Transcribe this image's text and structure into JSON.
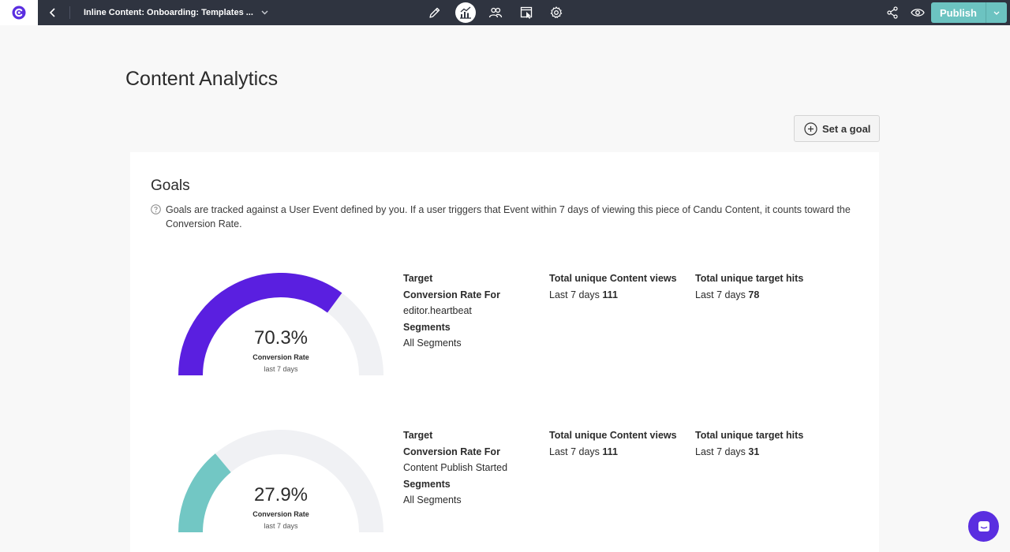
{
  "topbar": {
    "title": "Inline Content: Onboarding: Templates ...",
    "publish_label": "Publish",
    "icons": [
      "candu-logo-icon",
      "back-icon",
      "chevron-down-icon",
      "pencil-icon",
      "analytics-icon",
      "users-icon",
      "select-icon",
      "gear-icon",
      "share-icon",
      "eye-icon"
    ]
  },
  "page": {
    "title": "Content Analytics",
    "set_goal_label": "Set a goal"
  },
  "goals": {
    "title": "Goals",
    "help_text": "Goals are tracked against a User Event defined by you. If a user triggers that Event within 7 days of viewing this piece of Candu Content, it counts toward the Conversion Rate.",
    "items": [
      {
        "rate": "70.3%",
        "rate_value": 70.3,
        "rate_label": "Conversion Rate",
        "period": "last 7 days",
        "color": "#5a1fe0",
        "target_label": "Target",
        "conv_for_label": "Conversion Rate For",
        "event": "editor.heartbeat",
        "segments_label": "Segments",
        "segments": "All Segments",
        "views_label": "Total unique Content views",
        "views_prefix": "Last 7 days",
        "views": "111",
        "hits_label": "Total unique target hits",
        "hits_prefix": "Last 7 days",
        "hits": "78"
      },
      {
        "rate": "27.9%",
        "rate_value": 27.9,
        "rate_label": "Conversion Rate",
        "period": "last 7 days",
        "color": "#72c7c4",
        "target_label": "Target",
        "conv_for_label": "Conversion Rate For",
        "event": "Content Publish Started",
        "segments_label": "Segments",
        "segments": "All Segments",
        "views_label": "Total unique Content views",
        "views_prefix": "Last 7 days",
        "views": "111",
        "hits_label": "Total unique target hits",
        "hits_prefix": "Last 7 days",
        "hits": "31"
      }
    ]
  },
  "colors": {
    "topbar": "#2f3440",
    "accent": "#5a2ee0",
    "publish": "#6cc3c1",
    "track": "#f0f1f4"
  }
}
